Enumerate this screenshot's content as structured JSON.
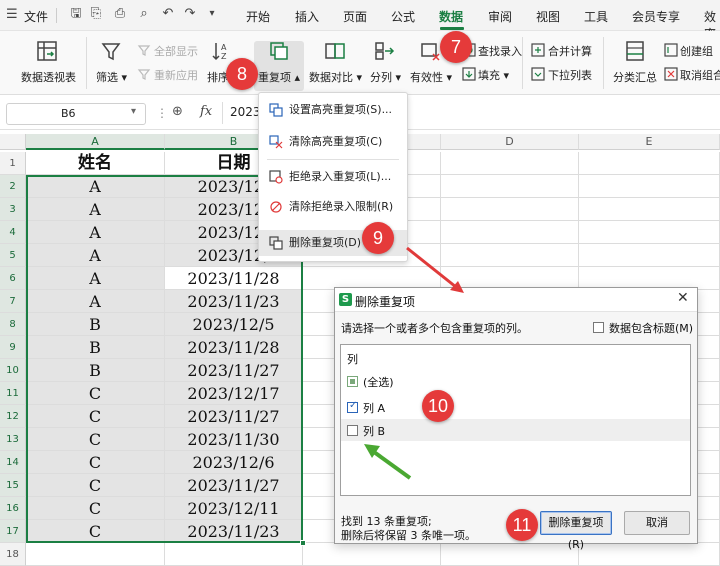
{
  "menubar": {
    "file_label": "文件",
    "tabs": [
      "开始",
      "插入",
      "页面",
      "公式",
      "数据",
      "审阅",
      "视图",
      "工具",
      "会员专享",
      "效率"
    ],
    "active_tab": "数据"
  },
  "ribbon": {
    "pivot_table": "数据透视表",
    "filter": "筛选",
    "show_all": "全部显示",
    "reapply": "重新应用",
    "sort": "排序",
    "duplicates": "重复项",
    "compare": "数据对比",
    "split": "分列",
    "validity": "有效性",
    "lookup": "查找录入",
    "fill": "填充",
    "consolidate": "合并计算",
    "dropdown_list": "下拉列表",
    "subtotal": "分类汇总",
    "create_group": "创建组",
    "ungroup": "取消组合"
  },
  "formula_bar": {
    "cell_ref": "B6",
    "fx": "fx",
    "value": "2023"
  },
  "sheet": {
    "columns": [
      "A",
      "B",
      "C",
      "D",
      "E"
    ],
    "rows": [
      "1",
      "2",
      "3",
      "4",
      "5",
      "6",
      "7",
      "8",
      "9",
      "10",
      "11",
      "12",
      "13",
      "14",
      "15",
      "16",
      "17",
      "18"
    ],
    "header": [
      "姓名",
      "日期"
    ],
    "data": [
      [
        "A",
        "2023/12/"
      ],
      [
        "A",
        "2023/12/"
      ],
      [
        "A",
        "2023/12/"
      ],
      [
        "A",
        "2023/12/"
      ],
      [
        "A",
        "2023/11/28"
      ],
      [
        "A",
        "2023/11/23"
      ],
      [
        "B",
        "2023/12/5"
      ],
      [
        "B",
        "2023/11/28"
      ],
      [
        "B",
        "2023/11/27"
      ],
      [
        "C",
        "2023/12/17"
      ],
      [
        "C",
        "2023/11/27"
      ],
      [
        "C",
        "2023/11/30"
      ],
      [
        "C",
        "2023/12/6"
      ],
      [
        "C",
        "2023/11/27"
      ],
      [
        "C",
        "2023/12/11"
      ],
      [
        "C",
        "2023/11/23"
      ]
    ]
  },
  "dropdown": {
    "items": [
      "设置高亮重复项(S)...",
      "清除高亮重复项(C)",
      "拒绝录入重复项(L)...",
      "清除拒绝录入限制(R)",
      "删除重复项(D)"
    ]
  },
  "dialog": {
    "title": "删除重复项",
    "prompt": "请选择一个或者多个包含重复项的列。",
    "header_checkbox": "数据包含标题(M)",
    "list_header": "列",
    "select_all": "(全选)",
    "col_a": "列 A",
    "col_b": "列 B",
    "result_line1": "找到 13 条重复项;",
    "result_line2": "删除后将保留 3 条唯一项。",
    "delete_button": "删除重复项(R)",
    "cancel_button": "取消"
  },
  "steps": [
    "7",
    "8",
    "9",
    "10",
    "11"
  ],
  "colors": {
    "accent_green": "#1b7f43",
    "marker_red": "#e53a3a",
    "arrow_green": "#4aa832",
    "arrow_red": "#e03a3a"
  }
}
